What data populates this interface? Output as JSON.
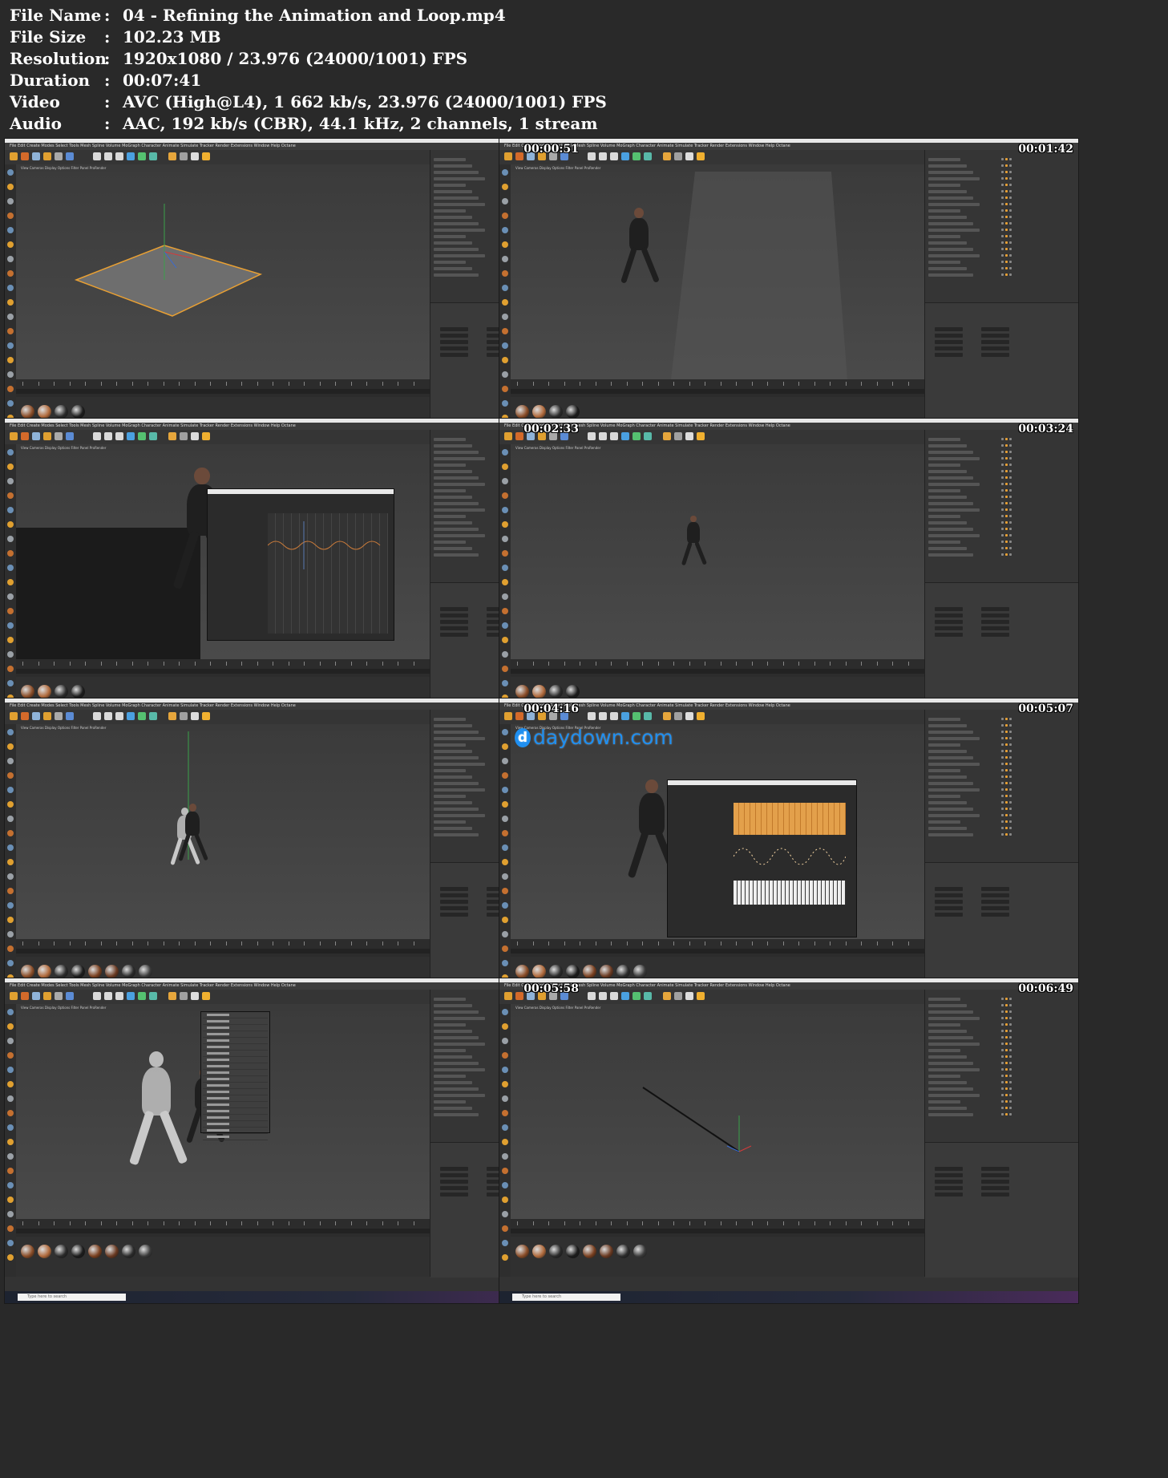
{
  "info": [
    {
      "label": "File Name",
      "sep": ":",
      "value": "04 - Refining the Animation and Loop.mp4"
    },
    {
      "label": "File Size",
      "sep": ":",
      "value": "102.23 MB"
    },
    {
      "label": "Resolution",
      "sep": ":",
      "value": "1920x1080 / 23.976 (24000/1001) FPS"
    },
    {
      "label": "Duration",
      "sep": ":",
      "value": "00:07:41"
    },
    {
      "label": "Video",
      "sep": ":",
      "value": "AVC (High@L4), 1 662 kb/s, 23.976 (24000/1001) FPS"
    },
    {
      "label": "Audio",
      "sep": ":",
      "value": "AAC, 192 kb/s (CBR), 44.1 kHz, 2 channels, 1 stream"
    }
  ],
  "watermark": {
    "text": "daydown.com",
    "logo": "d"
  },
  "thumbnails": [
    {
      "time": "00:00:51",
      "scene": "plane"
    },
    {
      "time": "00:01:42",
      "scene": "runner"
    },
    {
      "time": "00:02:33",
      "scene": "timeline-curve"
    },
    {
      "time": "00:03:24",
      "scene": "runner-small"
    },
    {
      "time": "00:04:16",
      "scene": "ghost"
    },
    {
      "time": "00:05:07",
      "scene": "timeline-keys"
    },
    {
      "time": "00:05:58",
      "scene": "window-menu"
    },
    {
      "time": "00:06:49",
      "scene": "spline"
    }
  ],
  "ui": {
    "menubar": "File  Edit  Create  Modes  Select  Tools  Mesh  Spline  Volume  MoGraph  Character  Animate  Simulate  Tracker  Render  Extensions  Window  Help  Octane",
    "viewport_menu": "View  Cameras  Display  Options  Filter  Panel  ProRender",
    "taskbar_search": "Type here to search",
    "colors": {
      "accent": "#e9a033",
      "background": "#292929",
      "watermark": "#1f8ff0"
    }
  }
}
